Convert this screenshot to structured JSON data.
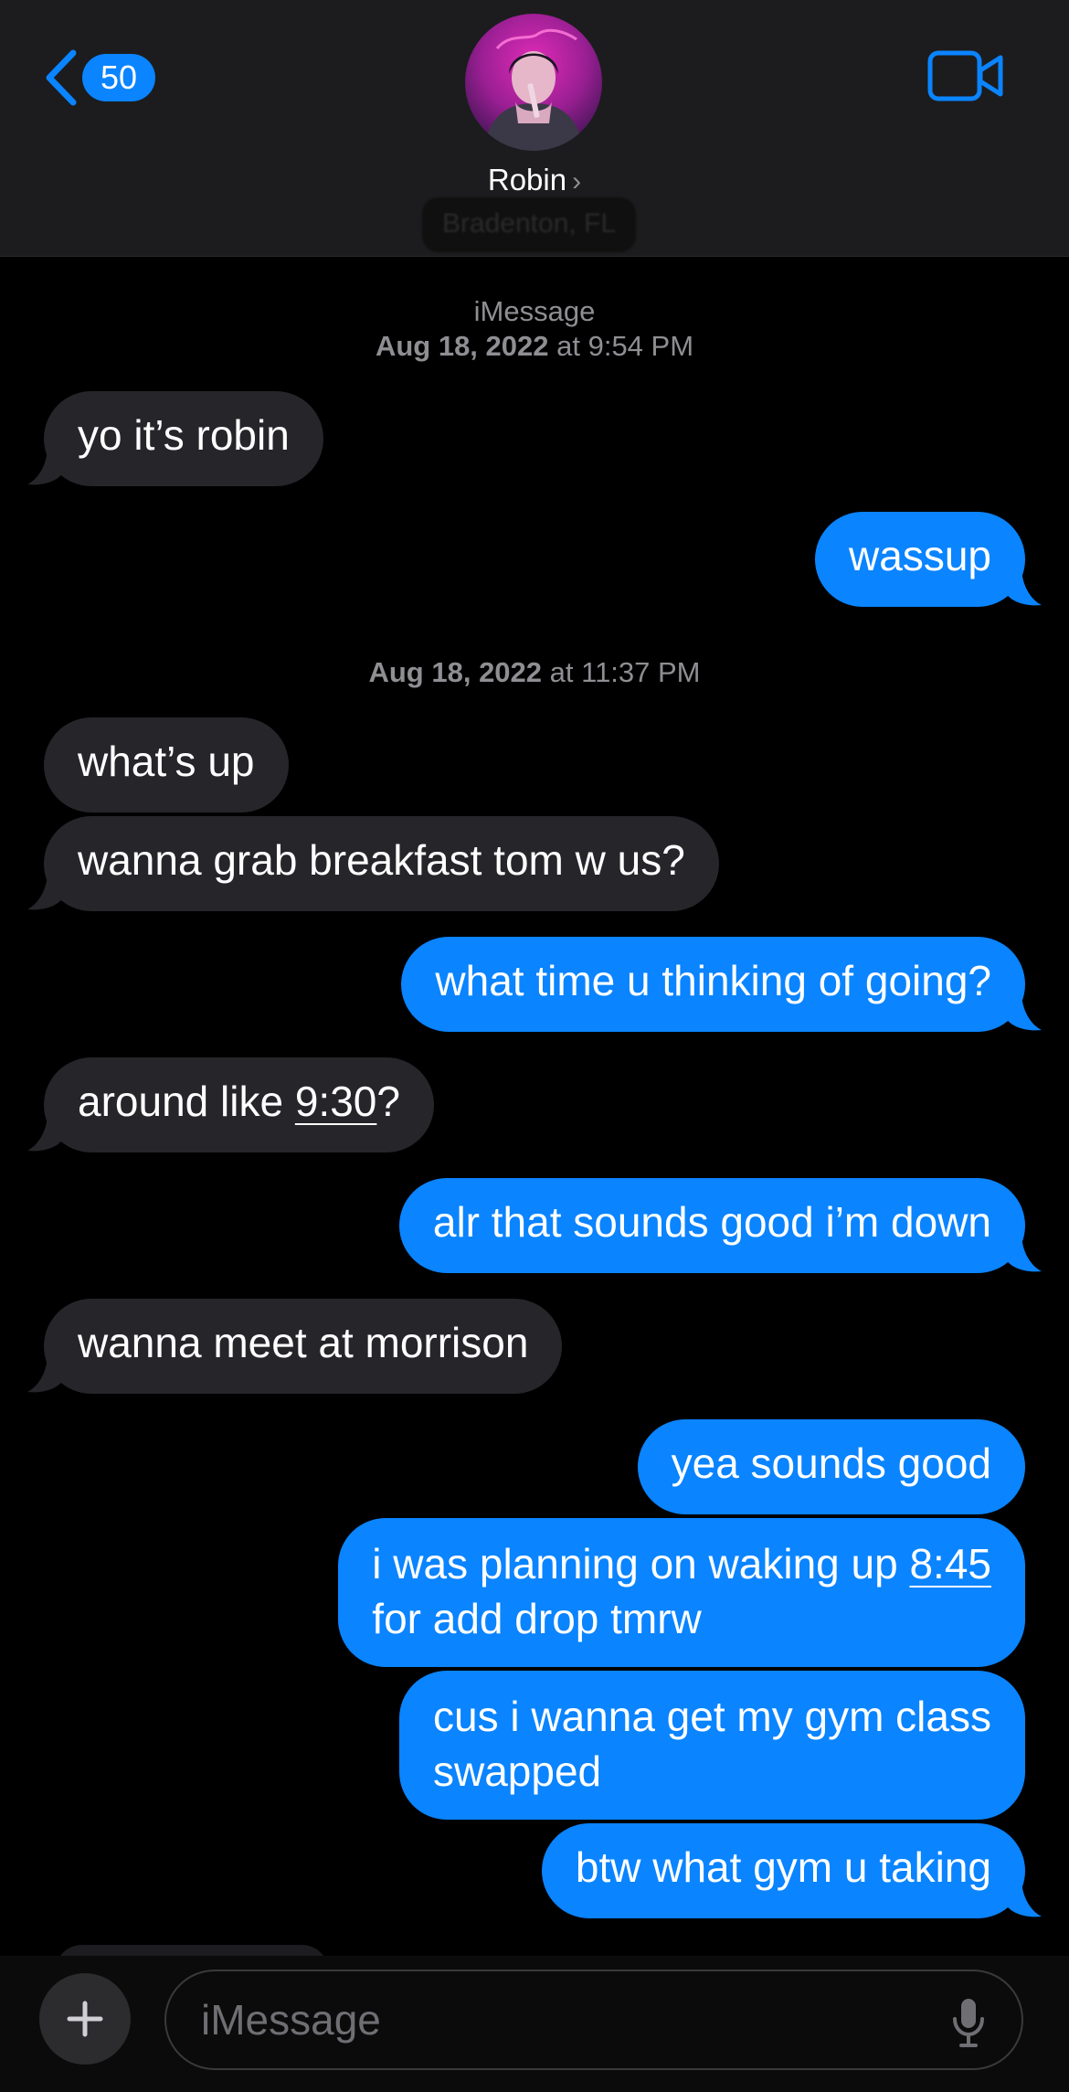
{
  "header": {
    "back_count": "50",
    "contact_name": "Robin",
    "contact_subtitle": "Bradenton, FL",
    "avatar_label": "friendship",
    "accent": "#0a84ff"
  },
  "thread": {
    "service_label": "iMessage",
    "timestamps": [
      {
        "date": "Aug 18, 2022",
        "time": "at 9:54 PM"
      },
      {
        "date": "Aug 18, 2022",
        "time": "at 11:37 PM"
      }
    ],
    "messages": [
      {
        "from": "them",
        "text": "yo it’s robin"
      },
      {
        "from": "me",
        "text": "wassup"
      },
      {
        "from": "them",
        "text": "what’s up"
      },
      {
        "from": "them",
        "text": "wanna grab breakfast tom w us?"
      },
      {
        "from": "me",
        "text": "what time u thinking of going?"
      },
      {
        "from": "them",
        "text_before": "around like ",
        "link": "9:30",
        "text_after": "?"
      },
      {
        "from": "me",
        "text": "alr that sounds good i’m down"
      },
      {
        "from": "them",
        "text": "wanna meet at morrison"
      },
      {
        "from": "me",
        "text": "yea sounds good"
      },
      {
        "from": "me",
        "line1_before": "i was planning on waking up ",
        "link": "8:45",
        "line2": "for add drop tmrw"
      },
      {
        "from": "me",
        "line1": "cus i wanna get my gym class",
        "line2": "swapped"
      },
      {
        "from": "me",
        "text": "btw what gym u taking"
      }
    ]
  },
  "composer": {
    "placeholder": "iMessage",
    "plus_icon": "plus-icon",
    "mic_icon": "microphone-icon"
  }
}
